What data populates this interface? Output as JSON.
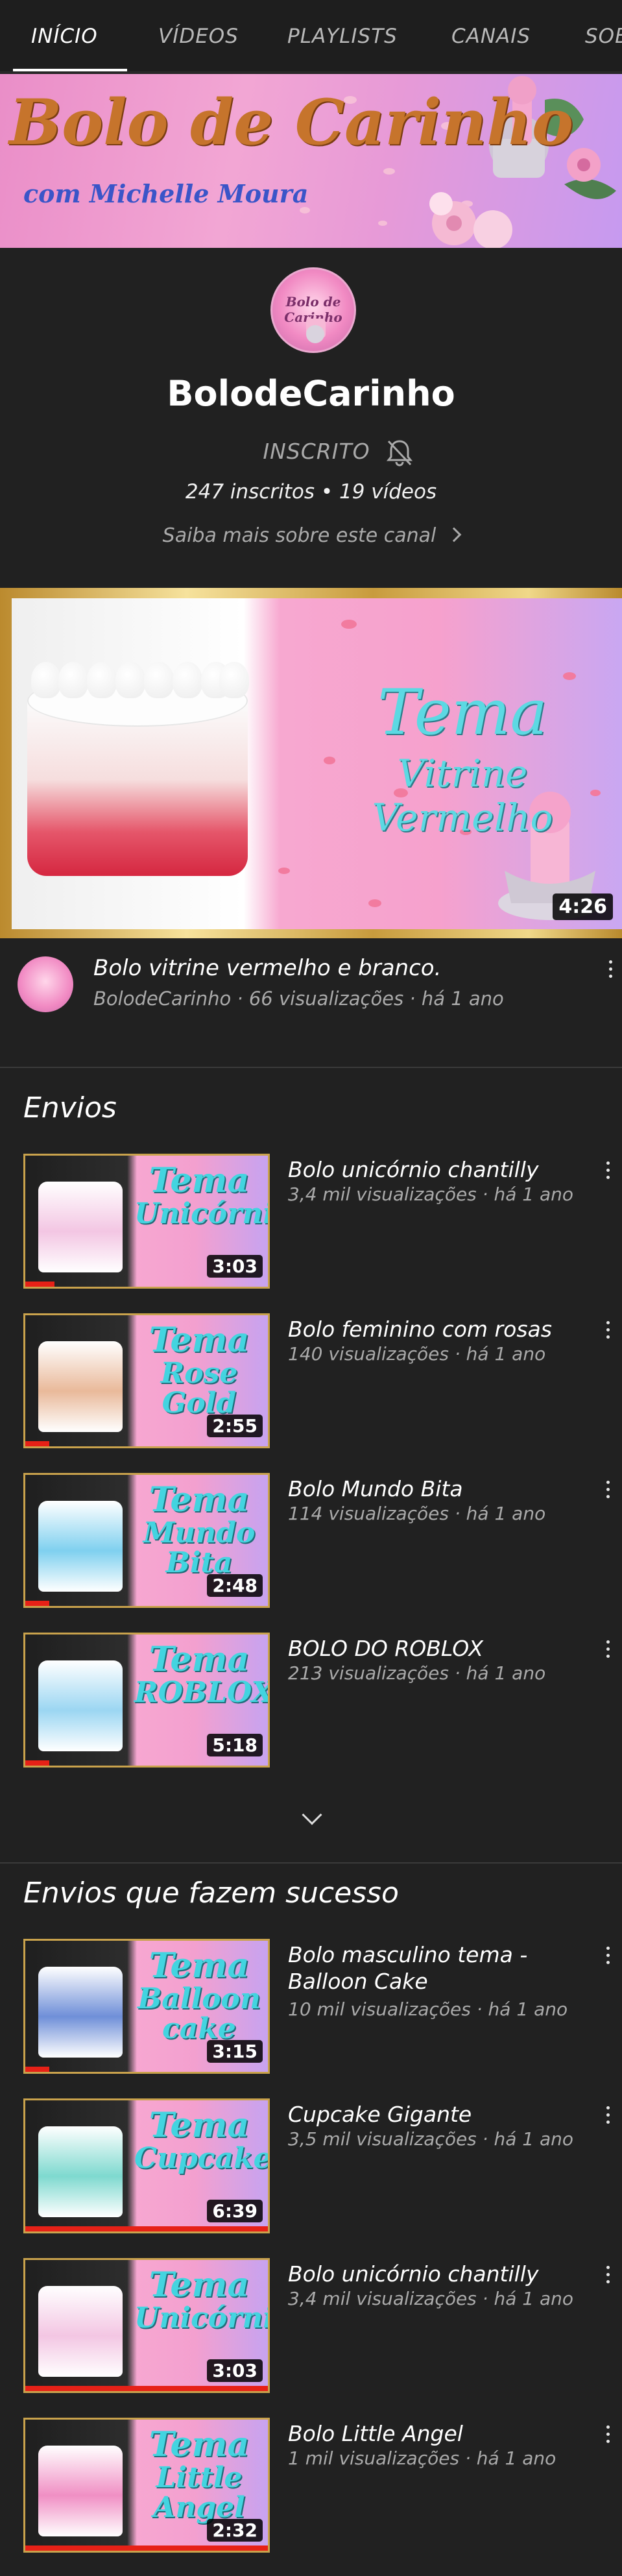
{
  "tabs": [
    {
      "label": "INÍCIO",
      "active": true
    },
    {
      "label": "VÍDEOS",
      "active": false
    },
    {
      "label": "PLAYLISTS",
      "active": false
    },
    {
      "label": "CANAIS",
      "active": false
    },
    {
      "label": "SOBRE",
      "active": false
    }
  ],
  "banner": {
    "title": "Bolo de Carinho",
    "subtitle": "com Michelle Moura"
  },
  "channel": {
    "avatar_text": "Bolo de Carinho",
    "name": "BolodeCarinho",
    "subscribe_state": "INSCRITO",
    "stats": "247 inscritos • 19 vídeos",
    "about": "Saiba mais sobre este canal"
  },
  "featured": {
    "thumb_title_line1": "Tema",
    "thumb_title_line2": "Vitrine Vermelho",
    "duration": "4:26",
    "title": "Bolo vitrine vermelho e branco.",
    "meta": "BolodeCarinho · 66 visualizações · há 1 ano"
  },
  "uploads": {
    "title": "Envios",
    "videos": [
      {
        "thumb_a": "Tema",
        "thumb_b": "Unicórnio",
        "duration": "3:03",
        "progress": 0.12,
        "title": "Bolo unicórnio chantilly",
        "meta": "3,4 mil visualizações · há 1 ano",
        "cake_color": "#f3c6e3"
      },
      {
        "thumb_a": "Tema",
        "thumb_b": "Rose Gold",
        "duration": "2:55",
        "progress": 0.1,
        "title": "Bolo feminino com rosas",
        "meta": "140 visualizações · há 1 ano",
        "cake_color": "#e9b99a"
      },
      {
        "thumb_a": "Tema",
        "thumb_b": "Mundo Bita",
        "duration": "2:48",
        "progress": 0.1,
        "title": "Bolo Mundo Bita",
        "meta": "114 visualizações · há 1 ano",
        "cake_color": "#7fd0ef"
      },
      {
        "thumb_a": "Tema",
        "thumb_b": "ROBLOX",
        "duration": "5:18",
        "progress": 0.1,
        "title": "BOLO DO ROBLOX",
        "meta": "213 visualizações · há 1 ano",
        "cake_color": "#9bd6f2"
      }
    ]
  },
  "popular": {
    "title": "Envios que fazem sucesso",
    "videos": [
      {
        "thumb_a": "Tema",
        "thumb_b": "Balloon cake",
        "duration": "3:15",
        "progress": 0.1,
        "title": "Bolo masculino tema - Balloon Cake",
        "meta": "10 mil visualizações · há 1 ano",
        "cake_color": "#6f8fd8"
      },
      {
        "thumb_a": "Tema",
        "thumb_b": "Cupcake",
        "duration": "6:39",
        "progress": 1.0,
        "title": "Cupcake Gigante",
        "meta": "3,5 mil visualizações · há 1 ano",
        "cake_color": "#7ed9cf"
      },
      {
        "thumb_a": "Tema",
        "thumb_b": "Unicórnio",
        "duration": "3:03",
        "progress": 1.0,
        "title": "Bolo unicórnio chantilly",
        "meta": "3,4 mil visualizações · há 1 ano",
        "cake_color": "#f3c6e3"
      },
      {
        "thumb_a": "Tema",
        "thumb_b": "Little Angel",
        "duration": "2:32",
        "progress": 1.0,
        "title": "Bolo Little Angel",
        "meta": "1 mil visualizações · há 1 ano",
        "cake_color": "#f08fc4"
      }
    ]
  },
  "colors": {
    "accent_red": "#e62117",
    "cyan_title": "#43d4e0",
    "background": "#212121"
  }
}
